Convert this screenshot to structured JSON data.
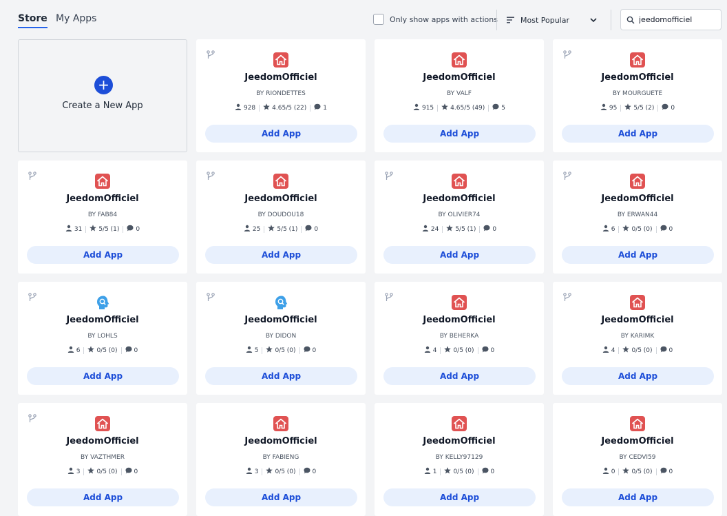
{
  "tabs": {
    "store": "Store",
    "my_apps": "My Apps"
  },
  "filter": {
    "label": "Only show apps with actions",
    "checked": false
  },
  "sort": {
    "label": "Most Popular"
  },
  "search": {
    "value": "jeedomofficiel",
    "icon": "search-icon"
  },
  "create": {
    "label": "Create a New App",
    "icon": "plus-icon"
  },
  "add_label": "Add App",
  "colors": {
    "accent": "#1d4ed8",
    "add_bg": "#e8f0fd",
    "house_icon": "#e05252",
    "head_icon": "#3ea0e8"
  },
  "apps": [
    {
      "name": "JeedomOfficiel",
      "author": "BY RIONDETTES",
      "users": "928",
      "rating": "4.65/5 (22)",
      "comments": "1",
      "icon": "house",
      "fork": true
    },
    {
      "name": "JeedomOfficiel",
      "author": "BY VALF",
      "users": "915",
      "rating": "4.65/5 (49)",
      "comments": "5",
      "icon": "house",
      "fork": false
    },
    {
      "name": "JeedomOfficiel",
      "author": "BY MOURGUETE",
      "users": "95",
      "rating": "5/5 (2)",
      "comments": "0",
      "icon": "house",
      "fork": true
    },
    {
      "name": "JeedomOfficiel",
      "author": "BY FAB84",
      "users": "31",
      "rating": "5/5 (1)",
      "comments": "0",
      "icon": "house",
      "fork": true
    },
    {
      "name": "JeedomOfficiel",
      "author": "BY DOUDOU18",
      "users": "25",
      "rating": "5/5 (1)",
      "comments": "0",
      "icon": "house",
      "fork": true
    },
    {
      "name": "JeedomOfficiel",
      "author": "BY OLIVIER74",
      "users": "24",
      "rating": "5/5 (1)",
      "comments": "0",
      "icon": "house",
      "fork": true
    },
    {
      "name": "JeedomOfficiel",
      "author": "BY ERWAN44",
      "users": "6",
      "rating": "0/5 (0)",
      "comments": "0",
      "icon": "house",
      "fork": true
    },
    {
      "name": "JeedomOfficiel",
      "author": "BY LOHLS",
      "users": "6",
      "rating": "0/5 (0)",
      "comments": "0",
      "icon": "head",
      "fork": true
    },
    {
      "name": "JeedomOfficiel",
      "author": "BY DIDON",
      "users": "5",
      "rating": "0/5 (0)",
      "comments": "0",
      "icon": "head",
      "fork": true
    },
    {
      "name": "JeedomOfficiel",
      "author": "BY BEHERKA",
      "users": "4",
      "rating": "0/5 (0)",
      "comments": "0",
      "icon": "house",
      "fork": true
    },
    {
      "name": "JeedomOfficiel",
      "author": "BY KARIMK",
      "users": "4",
      "rating": "0/5 (0)",
      "comments": "0",
      "icon": "house",
      "fork": true
    },
    {
      "name": "JeedomOfficiel",
      "author": "BY VAZTHMER",
      "users": "3",
      "rating": "0/5 (0)",
      "comments": "0",
      "icon": "house",
      "fork": true
    },
    {
      "name": "JeedomOfficiel",
      "author": "BY FABIENG",
      "users": "3",
      "rating": "0/5 (0)",
      "comments": "0",
      "icon": "house",
      "fork": false
    },
    {
      "name": "JeedomOfficiel",
      "author": "BY KELLY97129",
      "users": "1",
      "rating": "0/5 (0)",
      "comments": "0",
      "icon": "house",
      "fork": false
    },
    {
      "name": "JeedomOfficiel",
      "author": "BY CEDVI59",
      "users": "0",
      "rating": "0/5 (0)",
      "comments": "0",
      "icon": "house",
      "fork": false
    }
  ]
}
